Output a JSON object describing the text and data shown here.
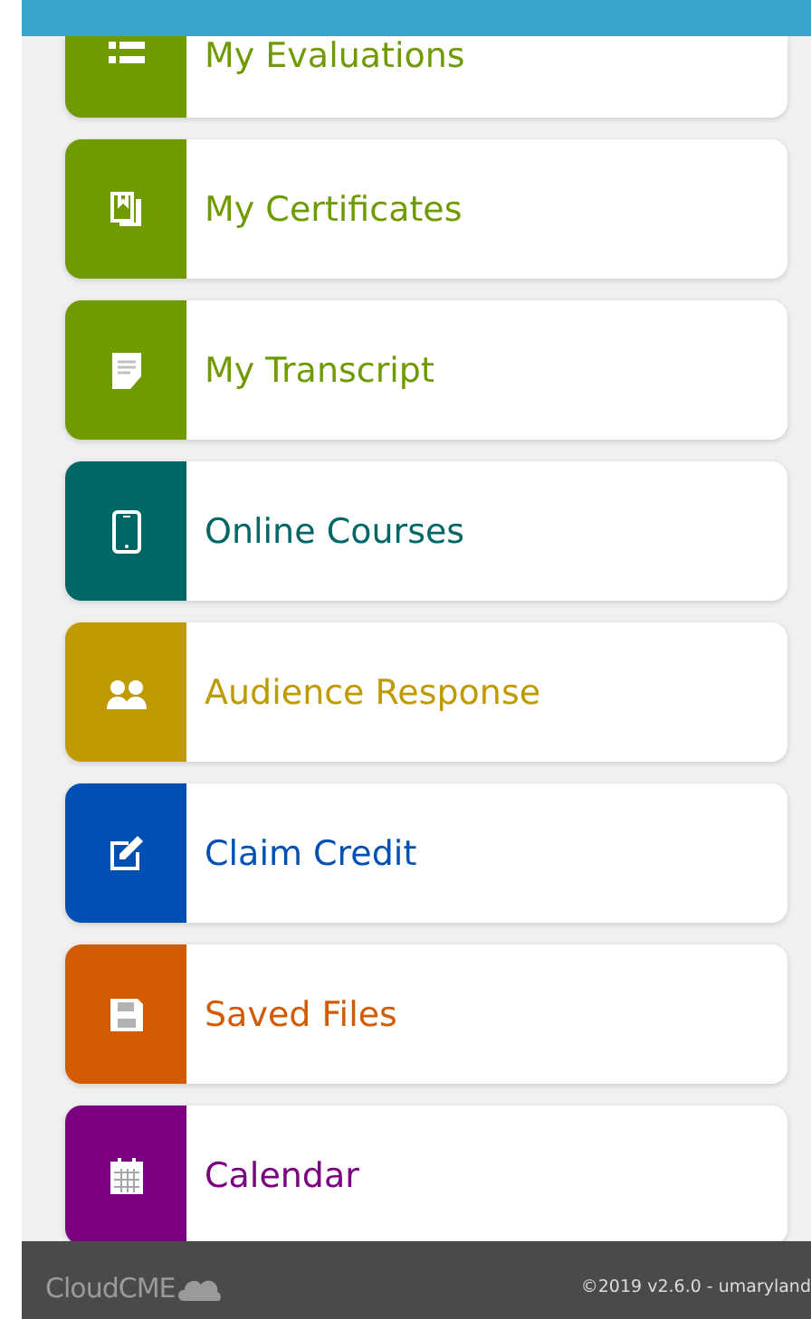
{
  "menu": [
    {
      "label": "My Evaluations",
      "kind": "list",
      "color": "#6f9a00"
    },
    {
      "label": "My Certificates",
      "kind": "book",
      "color": "#6f9a00"
    },
    {
      "label": "My Transcript",
      "kind": "document",
      "color": "#6f9a00"
    },
    {
      "label": "Online Courses",
      "kind": "tablet",
      "color": "#006666"
    },
    {
      "label": "Audience Response",
      "kind": "people",
      "color": "#bf9a00"
    },
    {
      "label": "Claim Credit",
      "kind": "edit",
      "color": "#0050b4"
    },
    {
      "label": "Saved Files",
      "kind": "save",
      "color": "#d25a00"
    },
    {
      "label": "Calendar",
      "kind": "calendar",
      "color": "#7a0080"
    }
  ],
  "footer": {
    "brand": "CloudCME",
    "copyright": "©2019 v2.6.0 -  umaryland"
  }
}
